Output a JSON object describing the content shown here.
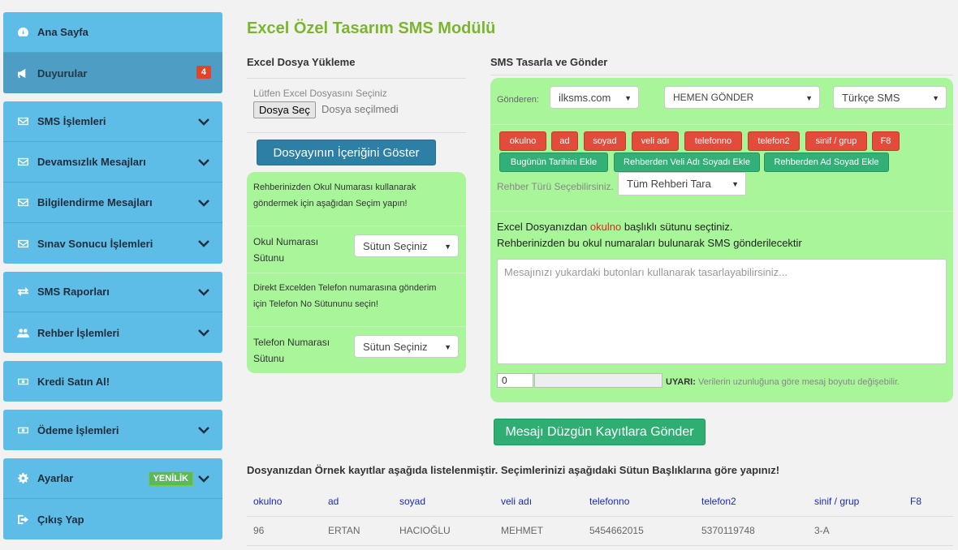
{
  "sidebar": {
    "groups": [
      {
        "items": [
          {
            "label": "Ana Sayfa",
            "icon": "dashboard-icon"
          },
          {
            "label": "Duyurular",
            "icon": "megaphone-icon",
            "badge": "4",
            "active": true
          }
        ]
      },
      {
        "items": [
          {
            "label": "SMS İşlemleri",
            "icon": "envelope-icon"
          },
          {
            "label": "Devamsızlık Mesajları",
            "icon": "envelope-icon"
          },
          {
            "label": "Bilgilendirme Mesajları",
            "icon": "envelope-icon"
          },
          {
            "label": "Sınav Sonucu İşlemleri",
            "icon": "envelope-icon"
          }
        ]
      },
      {
        "items": [
          {
            "label": "SMS Raporları",
            "icon": "exchange-icon"
          },
          {
            "label": "Rehber İşlemleri",
            "icon": "users-icon"
          }
        ]
      },
      {
        "items": [
          {
            "label": "Kredi Satın Al!",
            "icon": "money-icon"
          }
        ]
      },
      {
        "items": [
          {
            "label": "Ödeme İşlemleri",
            "icon": "money-icon"
          }
        ]
      },
      {
        "items": [
          {
            "label": "Ayarlar",
            "icon": "gear-icon",
            "badge": "YENİLİK"
          },
          {
            "label": "Çıkış Yap",
            "icon": "signout-icon"
          }
        ]
      }
    ]
  },
  "main": {
    "title": "Excel Özel Tasarım SMS Modülü",
    "upload": {
      "heading": "Excel Dosya Yükleme",
      "label": "Lütfen Excel Dosyasını Seçiniz",
      "choose_button": "Dosya Seç",
      "no_file": "Dosya seçilmedi",
      "show_button": "Dosyayının İçeriğini Göster",
      "hint1": "Rehberinizden Okul Numarası kullanarak göndermek için aşağıdan Seçim yapın!",
      "okul_label": "Okul Numarası Sütunu",
      "okul_select": "Sütun Seçiniz",
      "hint2": "Direkt Excelden Telefon numarasına gönderim için Telefon No Sütununu seçin!",
      "tel_label": "Telefon Numarası Sütunu",
      "tel_select": "Sütun Seçiniz"
    },
    "design": {
      "heading": "SMS Tasarla ve Gönder",
      "sender_label": "Gönderen:",
      "sender_value": "ilksms.com",
      "timing_value": "HEMEN GÖNDER",
      "lang_value": "Türkçe SMS",
      "tags": [
        "okulno",
        "ad",
        "soyad",
        "veli adı",
        "telefonno",
        "telefon2",
        "sinif / grup",
        "F8"
      ],
      "green_buttons": [
        "Bugünün Tarihini Ekle",
        "Rehberden Veli Adı Soyadı Ekle",
        "Rehberden Ad Soyad Ekle"
      ],
      "rehber_label": "Rehber Türü Seçebilirsiniz.",
      "rehber_value": "Tüm Rehberi Tara",
      "info1_pre": "Excel Dosyanızdan ",
      "info1_col": "okulno",
      "info1_post": " başlıklı sütunu seçtiniz.",
      "info2": "Rehberinizden bu okul numaraları bulunarak SMS gönderilecektir",
      "message_placeholder": "Mesajınızı yukardaki butonları kullanarak tasarlayabilirsiniz...",
      "char_count": "0",
      "warning_label": "UYARI:",
      "warning_text": " Verilerin uzunluğuna göre mesaj boyutu değişebilir."
    },
    "send_button": "Mesajı Düzgün Kayıtlara Gönder",
    "sample": {
      "heading": "Dosyanızdan Örnek kayıtlar aşağıda listelenmiştir. Seçimlerinizi aşağıdaki Sütun Başlıklarına göre yapınız!",
      "columns": [
        "okulno",
        "ad",
        "soyad",
        "veli adı",
        "telefonno",
        "telefon2",
        "sinif / grup",
        "F8"
      ],
      "rows": [
        [
          "96",
          "ERTAN",
          "HACIOĞLU",
          "MEHMET",
          "5454662015",
          "5370119748",
          "3-A",
          ""
        ]
      ]
    }
  }
}
